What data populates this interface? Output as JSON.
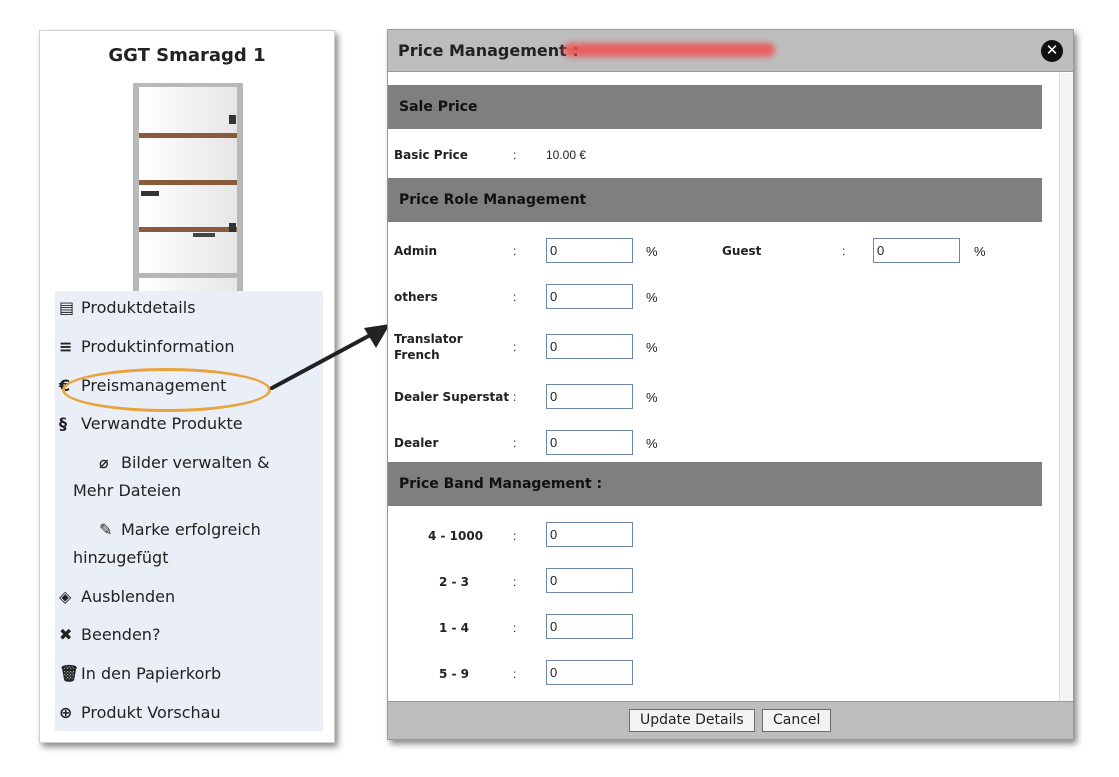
{
  "product": {
    "title": "GGT Smaragd 1"
  },
  "menu": {
    "items": [
      {
        "icon": "list-alt-icon",
        "glyph": "▤",
        "label": "Produktdetails"
      },
      {
        "icon": "lines-icon",
        "glyph": "≡",
        "label": "Produktinformation"
      },
      {
        "icon": "euro-icon",
        "glyph": "€",
        "label": "Preismanagement"
      },
      {
        "icon": "link-icon",
        "glyph": "§",
        "label": "Verwandte Produkte"
      },
      {
        "icon": "paperclip-icon",
        "glyph": "⌀",
        "label": "Bilder verwalten & Mehr Dateien"
      },
      {
        "icon": "edit-icon",
        "glyph": "✎",
        "label": "Marke erfolgreich hinzugefügt"
      },
      {
        "icon": "eye-slash-icon",
        "glyph": "◈",
        "label": "Ausblenden"
      },
      {
        "icon": "close-x-icon",
        "glyph": "✖",
        "label": "Beenden?"
      },
      {
        "icon": "trash-icon",
        "glyph": "🗑",
        "label": "In den Papierkorb"
      },
      {
        "icon": "zoom-in-icon",
        "glyph": "⊕",
        "label": "Produkt Vorschau"
      }
    ],
    "highlight_color": "#e8a33d"
  },
  "dialog": {
    "title": "Price Management  :",
    "sale_price": {
      "header": "Sale Price",
      "basic_label": "Basic Price",
      "colon": ":",
      "basic_value": "10.00 €"
    },
    "role": {
      "header": "Price Role Management",
      "rows": [
        {
          "label": "Admin",
          "value": "0",
          "unit": "%"
        },
        {
          "label": "Guest",
          "value": "0",
          "unit": "%"
        },
        {
          "label": "others",
          "value": "0",
          "unit": "%"
        },
        {
          "label": "Translator French",
          "value": "0",
          "unit": "%"
        },
        {
          "label": "Dealer Superstat",
          "value": "0",
          "unit": "%"
        },
        {
          "label": "Dealer",
          "value": "0",
          "unit": "%"
        }
      ]
    },
    "band": {
      "header": "Price Band Management   :",
      "rows": [
        {
          "label": "4 - 1000",
          "value": "0"
        },
        {
          "label": "2 - 3",
          "value": "0"
        },
        {
          "label": "1 - 4",
          "value": "0"
        },
        {
          "label": "5 - 9",
          "value": "0"
        }
      ]
    },
    "footer": {
      "update_label": "Update Details",
      "cancel_label": "Cancel"
    },
    "close_glyph": "✕"
  },
  "colors": {
    "section_bg": "#7f7f7f",
    "header_bg": "#bdbdbd",
    "menu_bg": "#e9eef7",
    "redacted": "#f05050"
  }
}
